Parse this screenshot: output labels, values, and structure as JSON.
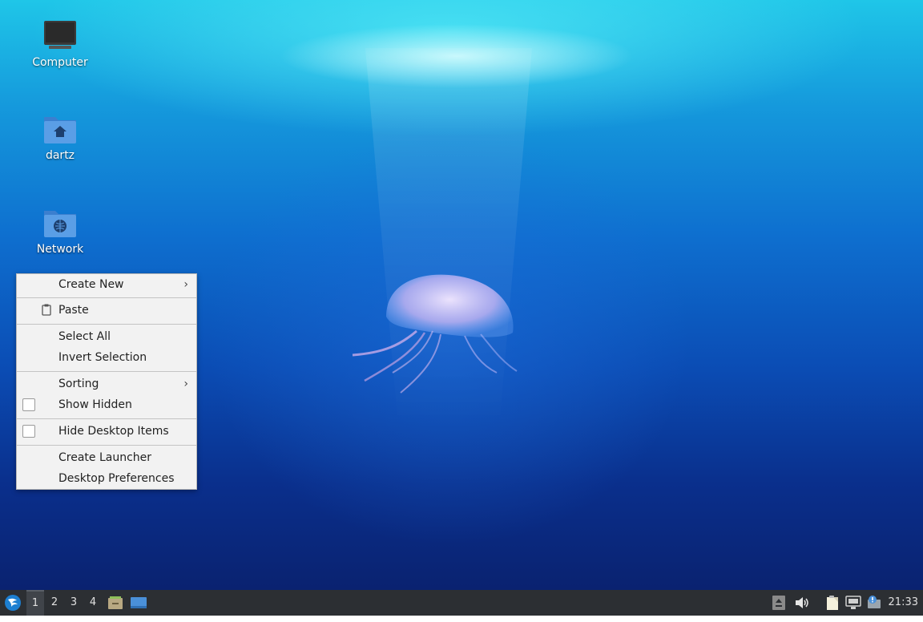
{
  "desktop": {
    "icons": [
      {
        "label": "Computer",
        "icon": "computer-icon"
      },
      {
        "label": "dartz",
        "icon": "home-folder-icon"
      },
      {
        "label": "Network",
        "icon": "network-folder-icon"
      }
    ]
  },
  "context_menu": {
    "items": [
      {
        "label": "Create New",
        "submenu": true
      },
      {
        "label": "Paste",
        "icon": "paste-icon"
      },
      {
        "label": "Select All"
      },
      {
        "label": "Invert Selection"
      },
      {
        "label": "Sorting",
        "submenu": true
      },
      {
        "label": "Show Hidden",
        "checkbox": true,
        "checked": false
      },
      {
        "label": "Hide Desktop Items",
        "checkbox": true,
        "checked": false
      },
      {
        "label": "Create Launcher"
      },
      {
        "label": "Desktop Preferences"
      }
    ],
    "submenu_glyph": "›"
  },
  "taskbar": {
    "workspaces": [
      "1",
      "2",
      "3",
      "4"
    ],
    "active_workspace": "1",
    "clock": "21:33"
  },
  "colors": {
    "taskbar_bg": "#2c2f33",
    "menu_bg": "#f2f2f2",
    "folder_blue": "#4a90d9"
  }
}
